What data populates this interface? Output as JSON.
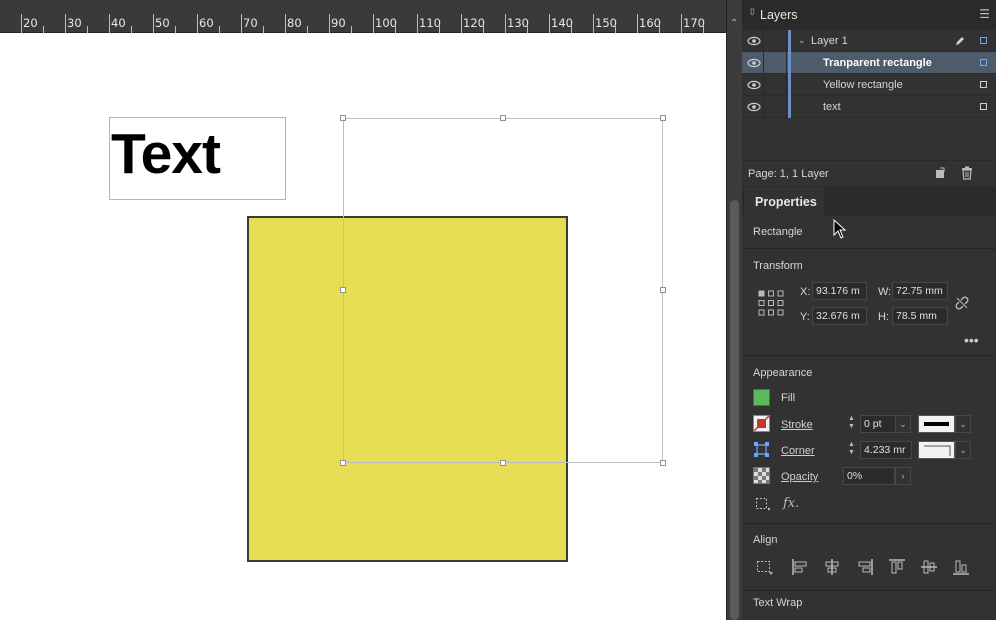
{
  "ruler": {
    "ticks": [
      "20",
      "30",
      "40",
      "50",
      "60",
      "70",
      "80",
      "90",
      "100",
      "110",
      "120",
      "130",
      "140",
      "150",
      "160",
      "170"
    ]
  },
  "canvas": {
    "text_frame_text": "Text",
    "yellow_color": "#e7de56"
  },
  "layers": {
    "title": "Layers",
    "items": [
      {
        "name": "Layer 1"
      },
      {
        "name": "Tranparent rectangle",
        "selected": true
      },
      {
        "name": "Yellow rectangle"
      },
      {
        "name": "text"
      }
    ],
    "footer": "Page: 1, 1 Layer"
  },
  "properties": {
    "title": "Properties",
    "object_type": "Rectangle",
    "transform": {
      "title": "Transform",
      "x_label": "X:",
      "x_value": "93.176 m",
      "y_label": "Y:",
      "y_value": "32.676 m",
      "w_label": "W:",
      "w_value": "72.75 mm",
      "h_label": "H:",
      "h_value": "78.5 mm"
    },
    "appearance": {
      "title": "Appearance",
      "fill_label": "Fill",
      "fill_color": "#5cb85c",
      "stroke_label": "Stroke",
      "stroke_value": "0 pt",
      "corner_label": "Corner",
      "corner_value": "4.233 mr",
      "opacity_label": "Opacity",
      "opacity_value": "0%"
    },
    "align": {
      "title": "Align"
    },
    "text_wrap": {
      "title": "Text Wrap"
    }
  }
}
